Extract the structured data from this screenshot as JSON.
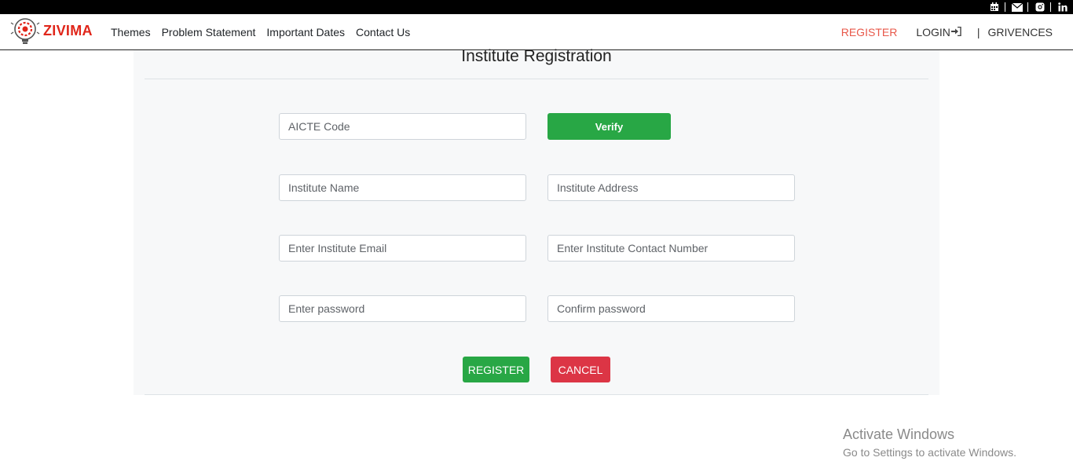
{
  "header": {
    "brand": "ZIVIMA",
    "nav": [
      "Themes",
      "Problem Statement",
      "Important Dates",
      "Contact Us"
    ],
    "register": "REGISTER",
    "login": "LOGIN",
    "divider": "|",
    "grievances": "GRIVENCES",
    "social_icons": [
      "calendar-icon",
      "mail-icon",
      "instagram-icon",
      "linkedin-icon"
    ]
  },
  "form": {
    "title": "Institute Registration",
    "aicte_placeholder": "AICTE Code",
    "verify_label": "Verify",
    "institute_name_placeholder": "Institute Name",
    "institute_address_placeholder": "Institute Address",
    "email_placeholder": "Enter Institute Email",
    "contact_placeholder": "Enter Institute Contact Number",
    "password_placeholder": "Enter password",
    "confirm_password_placeholder": "Confirm password",
    "register_label": "REGISTER",
    "cancel_label": "CANCEL"
  },
  "watermark": {
    "line1": "Activate Windows",
    "line2": "Go to Settings to activate Windows."
  },
  "colors": {
    "brand": "#e0261a",
    "success": "#28a745",
    "danger": "#dc3545",
    "register_link": "#e8584a"
  }
}
